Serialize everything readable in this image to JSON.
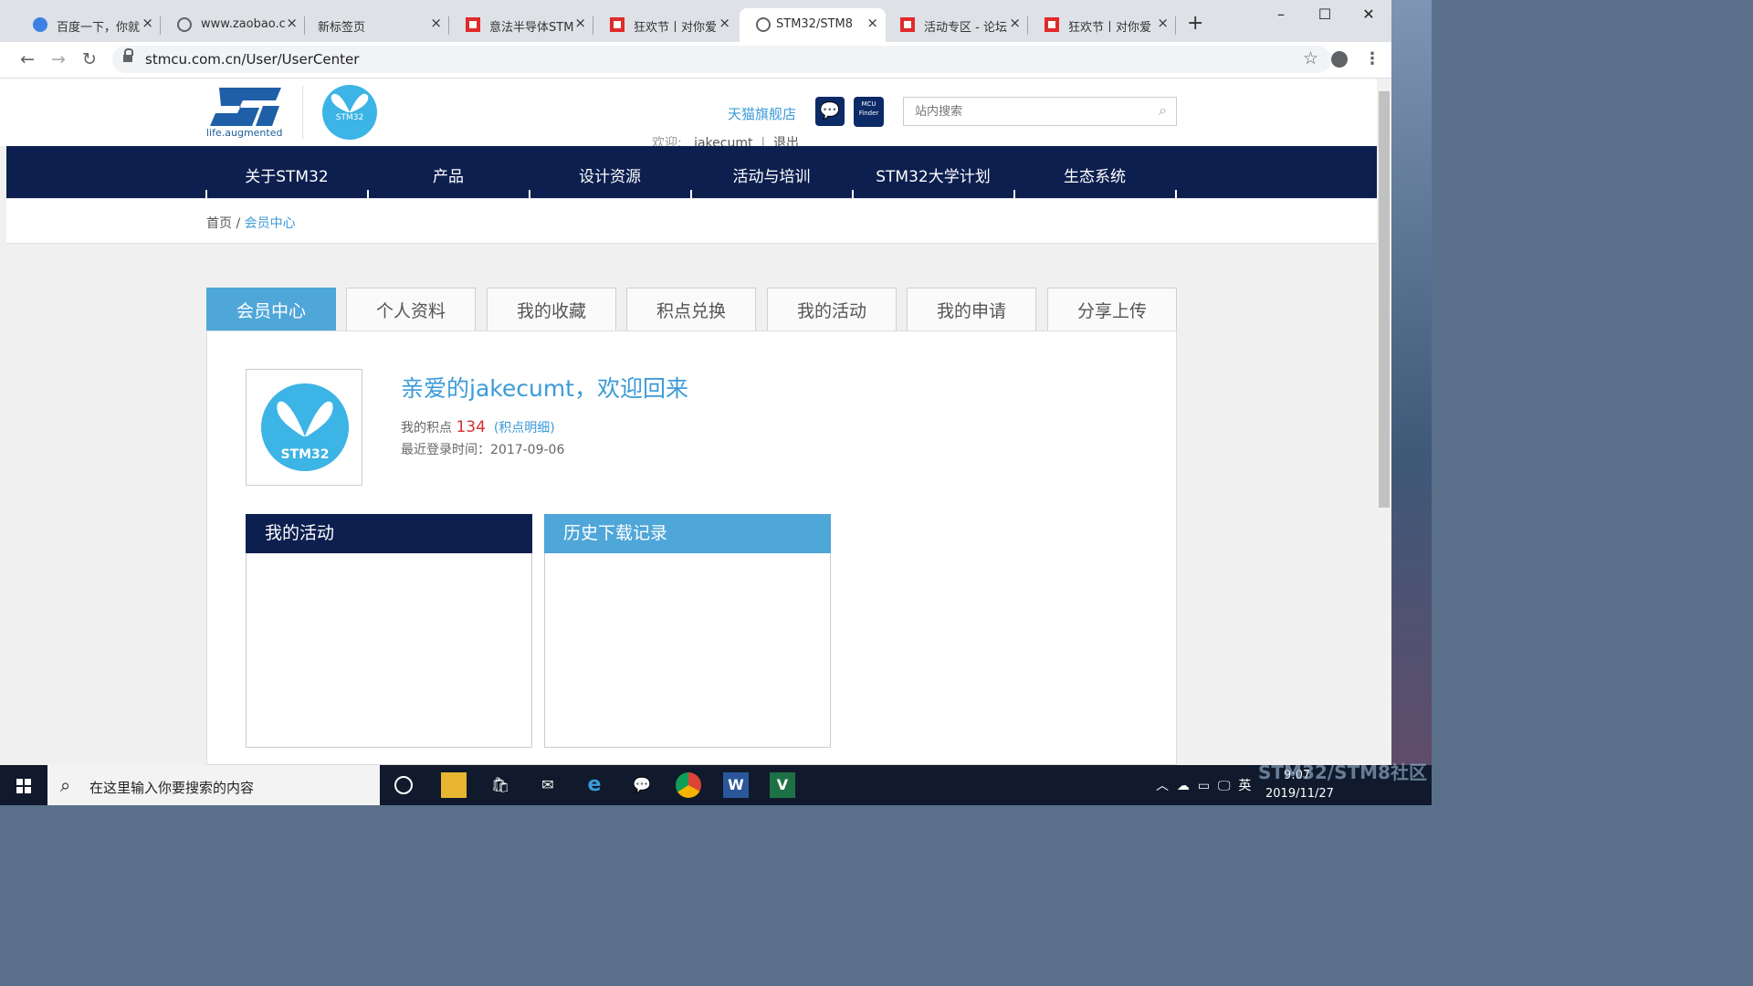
{
  "browser": {
    "tabs": [
      {
        "title": "百度一下，你就",
        "favicon": "paw-icon"
      },
      {
        "title": "www.zaobao.c",
        "favicon": "globe-icon"
      },
      {
        "title": "新标签页",
        "favicon": "none"
      },
      {
        "title": "意法半导体STM",
        "favicon": "red-square-icon"
      },
      {
        "title": "狂欢节丨对你爱",
        "favicon": "red-square-icon"
      },
      {
        "title": "STM32/STM8",
        "favicon": "globe-icon",
        "active": true
      },
      {
        "title": "活动专区 - 论坛",
        "favicon": "red-square-icon"
      },
      {
        "title": "狂欢节丨对你爱",
        "favicon": "red-square-icon"
      }
    ],
    "url": "stmcu.com.cn/User/UserCenter"
  },
  "site": {
    "tagline": "life.augmented",
    "stm32_badge": "STM32",
    "tmall_link": "天猫旗舰店",
    "search_placeholder": "站内搜索",
    "welcome_label": "欢迎:",
    "username": "jakecumt",
    "separator": "|",
    "logout": "退出",
    "nav": [
      "关于STM32",
      "产品",
      "设计资源",
      "活动与培训",
      "STM32大学计划",
      "生态系统"
    ],
    "breadcrumb": {
      "home": "首页",
      "sep": "/",
      "current": "会员中心"
    }
  },
  "member": {
    "tabs": [
      "会员中心",
      "个人资料",
      "我的收藏",
      "积点兑换",
      "我的活动",
      "我的申请",
      "分享上传"
    ],
    "greeting": "亲爱的jakecumt，欢迎回来",
    "points_label": "我的积点",
    "points_value": "134",
    "points_link": "(积点明细)",
    "last_login_label": "最近登录时间：",
    "last_login_value": "2017-09-06",
    "avatar_text": "STM32",
    "box_activities": "我的活动",
    "box_downloads": "历史下载记录",
    "colors": {
      "accent": "#4fa6d8",
      "navy": "#0c1f4f",
      "points": "#d32f2f"
    }
  },
  "watermark": "STM32/STM8社区",
  "taskbar": {
    "search_placeholder": "在这里输入你要搜索的内容",
    "ime": "英",
    "time": "9:07",
    "date": "2019/11/27"
  }
}
